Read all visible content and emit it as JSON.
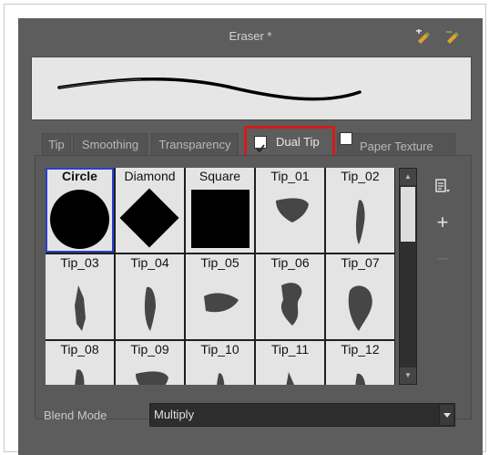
{
  "window": {
    "title": "Eraser *"
  },
  "header_icons": [
    "add-preset-icon",
    "rename-preset-icon"
  ],
  "tabs": [
    {
      "label": "Tip"
    },
    {
      "label": "Smoothing"
    },
    {
      "label": "Transparency"
    },
    {
      "label": "Dual Tip",
      "checked": true,
      "highlighted": true
    },
    {
      "label": "Paper Texture",
      "checked": false
    }
  ],
  "tips": [
    {
      "label": "Circle",
      "shape": "circle",
      "selected": true
    },
    {
      "label": "Diamond",
      "shape": "diamond"
    },
    {
      "label": "Square",
      "shape": "square"
    },
    {
      "label": "Tip_01",
      "shape": "texture"
    },
    {
      "label": "Tip_02",
      "shape": "texture"
    },
    {
      "label": "Tip_03",
      "shape": "texture"
    },
    {
      "label": "Tip_04",
      "shape": "texture"
    },
    {
      "label": "Tip_05",
      "shape": "texture"
    },
    {
      "label": "Tip_06",
      "shape": "texture"
    },
    {
      "label": "Tip_07",
      "shape": "texture"
    },
    {
      "label": "Tip_08",
      "shape": "texture"
    },
    {
      "label": "Tip_09",
      "shape": "texture"
    },
    {
      "label": "Tip_10",
      "shape": "texture"
    },
    {
      "label": "Tip_11",
      "shape": "texture"
    },
    {
      "label": "Tip_12",
      "shape": "texture"
    }
  ],
  "side_buttons": {
    "menu": "menu-icon",
    "add": "+",
    "remove": "−"
  },
  "blend": {
    "label": "Blend Mode",
    "value": "Multiply"
  },
  "colors": {
    "highlight": "#d41b1b",
    "selection": "#2b3fcf",
    "panel": "#5d5d5d"
  }
}
